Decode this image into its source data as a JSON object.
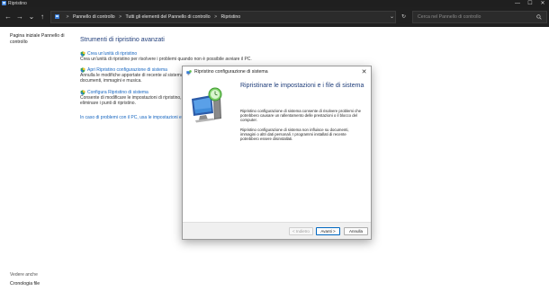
{
  "window": {
    "title": "Ripristino",
    "minimize_glyph": "—",
    "maximize_glyph": "☐",
    "close_glyph": "✕"
  },
  "address_bar": {
    "back_glyph": "←",
    "forward_glyph": "→",
    "dropdown_glyph": "⌄",
    "up_glyph": "↑",
    "separator": ">",
    "breadcrumbs": [
      "Pannello di controllo",
      "Tutti gli elementi del Pannello di controllo",
      "Ripristino"
    ],
    "address_dropdown_glyph": "⌄",
    "refresh_glyph": "↻",
    "search_placeholder": "Cerca nel Pannello di controllo"
  },
  "sidebar": {
    "home_link": "Pagina iniziale Pannello di controllo",
    "see_also": "Vedere anche",
    "file_history": "Cronologia file"
  },
  "main": {
    "title": "Strumenti di ripristino avanzati",
    "tools": [
      {
        "link": "Crea un'unità di ripristino",
        "description": "Crea un'unità di ripristino per risolvere i problemi quando non è possibile avviare il PC."
      },
      {
        "link": "Apri Ripristino configurazione di sistema",
        "description": "Annulla le modifiche apportate di recente al sistema, ma lascia invariati i file, come documenti, immagini e musica."
      },
      {
        "link": "Configura Ripristino di sistema",
        "description": "Consente di modificare le impostazioni di ripristino, di gestire lo spazio su disco e di eliminare i punti di ripristino."
      }
    ],
    "trouble_link": "In caso di problemi con il PC, usa le impostazioni e prova a reimpostarlo"
  },
  "dialog": {
    "title": "Ripristino configurazione di sistema",
    "close_glyph": "✕",
    "heading": "Ripristinare le impostazioni e i file di sistema",
    "paragraph1": "Ripristino configurazione di sistema consente di risolvere problemi che potrebbero causare un rallentamento delle prestazioni o il blocco del computer.",
    "paragraph2": "Ripristino configurazione di sistema non influisce su documenti, immagini o altri dati personali. I programmi installati di recente potrebbero essere disinstallati.",
    "buttons": {
      "back": "< Indietro",
      "next": "Avanti >",
      "cancel": "Annulla"
    }
  },
  "colors": {
    "titlebar_bg": "#1f1f1f",
    "addressbar_bg": "#202020",
    "link": "#1565c0",
    "heading": "#1f3d7a",
    "primary_button_border": "#0067c0"
  }
}
